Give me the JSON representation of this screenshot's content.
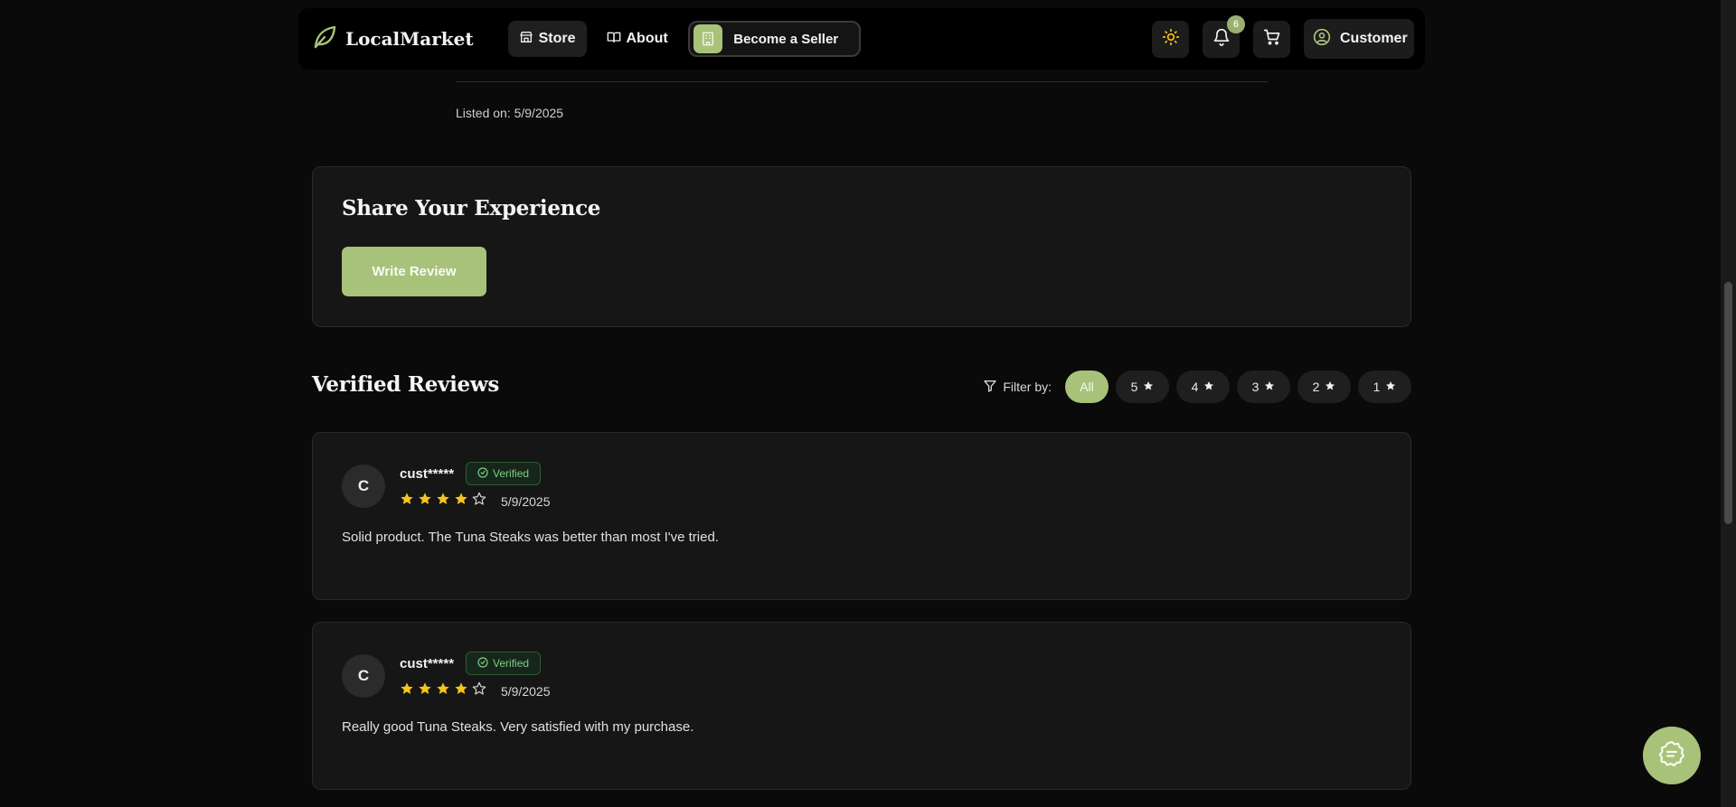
{
  "nav": {
    "brand": "LocalMarket",
    "links": [
      {
        "label": "Store",
        "icon": "store-icon",
        "active": true
      },
      {
        "label": "About",
        "icon": "book-icon",
        "active": false
      }
    ],
    "seller_button": "Become a Seller",
    "notification_count": "6",
    "customer_label": "Customer"
  },
  "product": {
    "listed_on": "Listed on: 5/9/2025"
  },
  "share": {
    "title": "Share Your Experience",
    "button": "Write Review"
  },
  "reviews_section": {
    "title": "Verified Reviews",
    "filter_label": "Filter by:",
    "filters": [
      "All",
      "5",
      "4",
      "3",
      "2",
      "1"
    ],
    "active_filter": "All"
  },
  "reviews": [
    {
      "initial": "C",
      "name": "cust*****",
      "badge": "Verified",
      "rating": 4,
      "max_rating": 5,
      "date": "5/9/2025",
      "text": "Solid product. The Tuna Steaks was better than most I've tried."
    },
    {
      "initial": "C",
      "name": "cust*****",
      "badge": "Verified",
      "rating": 4,
      "max_rating": 5,
      "date": "5/9/2025",
      "text": "Really good Tuna Steaks. Very satisfied with my purchase."
    }
  ],
  "colors": {
    "accent": "#a8c27a",
    "background": "#0a0a0a",
    "card": "#161616",
    "star": "#f5c518",
    "verified": "#7bcf84"
  }
}
